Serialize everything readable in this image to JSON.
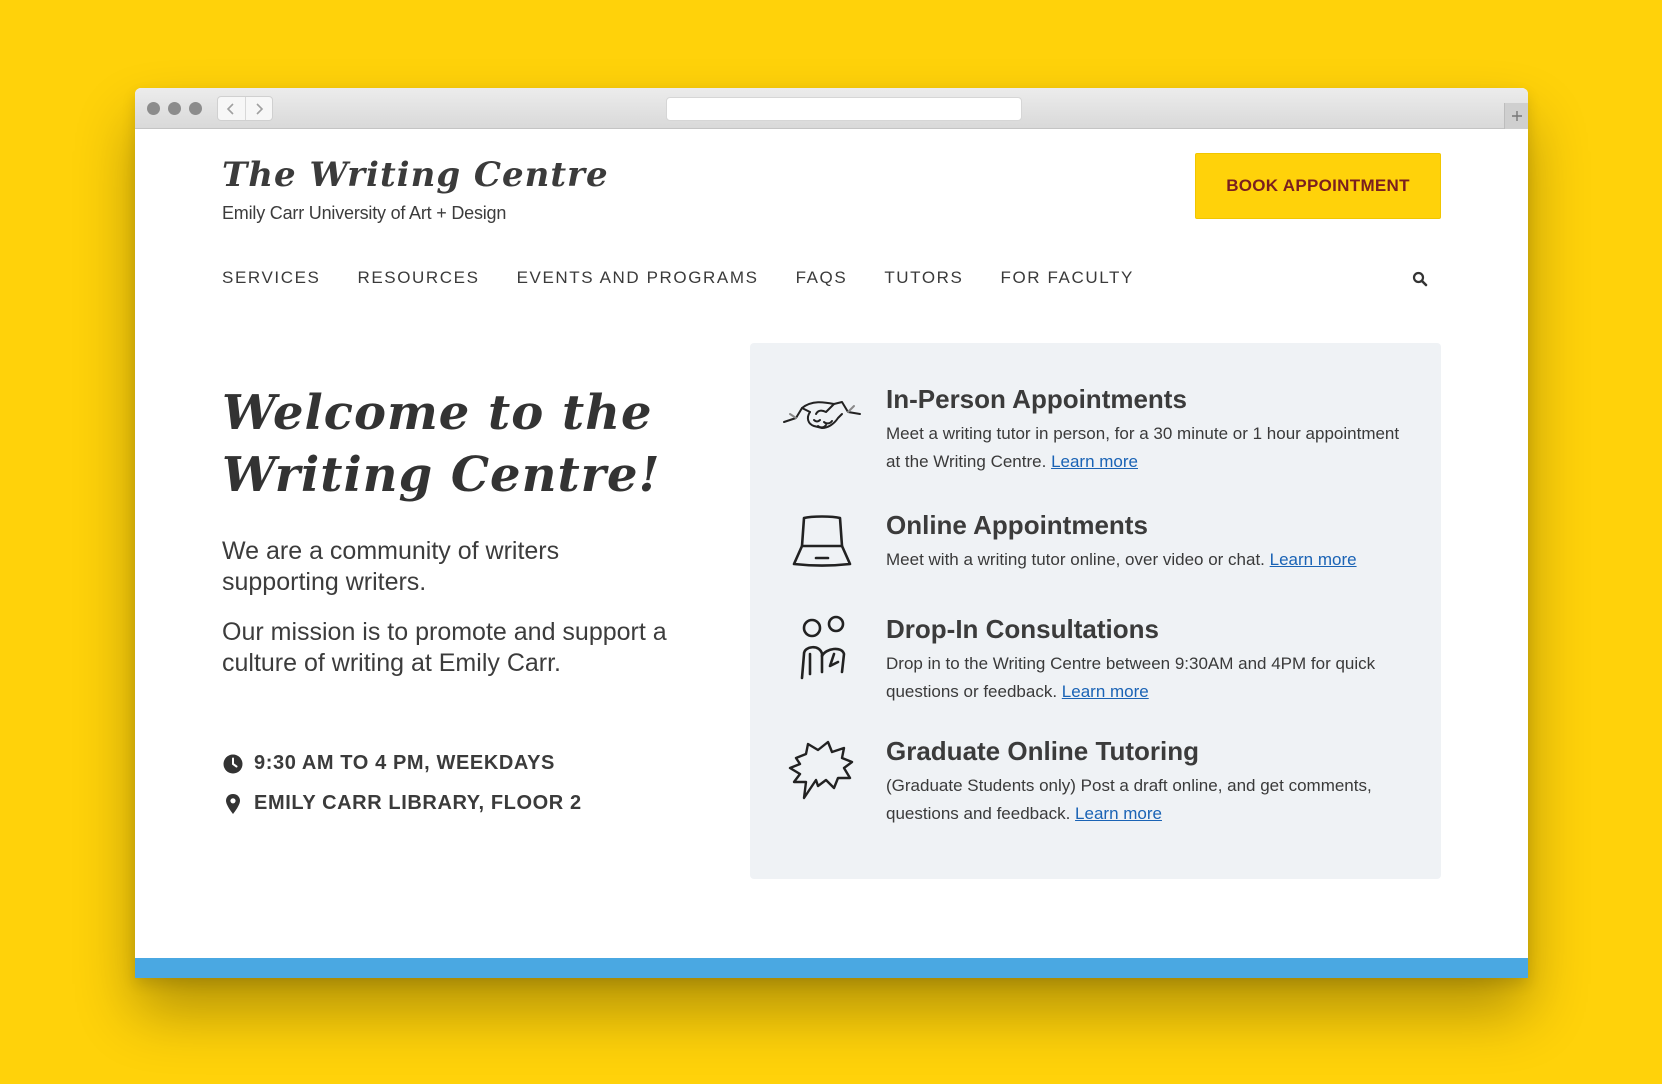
{
  "site": {
    "title": "The Writing Centre",
    "subtitle": "Emily Carr University of Art + Design",
    "book_button": "BOOK APPOINTMENT"
  },
  "nav": {
    "items": [
      "SERVICES",
      "RESOURCES",
      "EVENTS AND PROGRAMS",
      "FAQS",
      "TUTORS",
      "FOR FACULTY"
    ],
    "search_icon": "search-icon"
  },
  "hero": {
    "title": "Welcome to the Writing Centre!",
    "paragraph1": "We are a community of writers supporting writers.",
    "paragraph2": "Our mission is to promote and support a culture of writing at Emily Carr.",
    "hours": "9:30 AM TO 4 PM, WEEKDAYS",
    "location": "EMILY CARR LIBRARY, FLOOR 2"
  },
  "services": [
    {
      "icon": "handshake-icon",
      "title": "In-Person Appointments",
      "description": "Meet a writing tutor in person, for a 30 minute or 1 hour appointment at the Writing Centre.",
      "link": "Learn more"
    },
    {
      "icon": "laptop-icon",
      "title": "Online Appointments",
      "description": "Meet with a writing tutor online, over video or chat.",
      "link": "Learn more"
    },
    {
      "icon": "people-icon",
      "title": "Drop-In Consultations",
      "description": "Drop in to the Writing Centre between 9:30AM and 4PM for quick questions or feedback.",
      "link": "Learn more"
    },
    {
      "icon": "speech-bubble-icon",
      "title": "Graduate Online Tutoring",
      "description": "(Graduate Students only) Post a draft online, and get comments, questions and feedback.",
      "link": "Learn more"
    }
  ],
  "colors": {
    "background": "#FFD20A",
    "button": "#FFD20A",
    "button_text": "#7a1f1f",
    "panel": "#eff2f5",
    "link": "#1a63b5",
    "footer_strip": "#4aa8e2"
  }
}
